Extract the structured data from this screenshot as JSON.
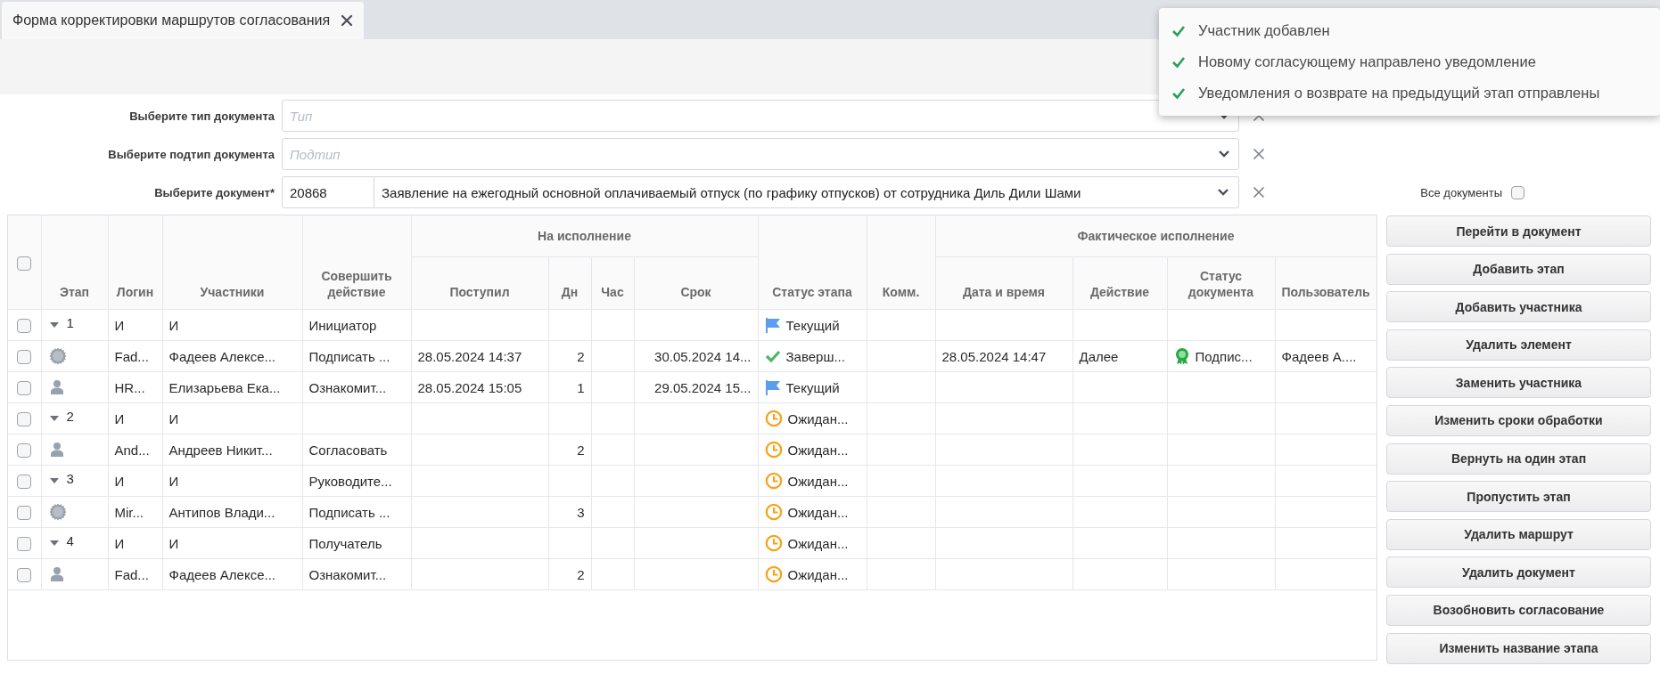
{
  "tabs": [
    {
      "label": "Форма корректировки маршрутов согласования",
      "selected": true
    }
  ],
  "form": {
    "fields": [
      {
        "kind": "select",
        "label": "Выберите тип документа",
        "placeholder": "Тип"
      },
      {
        "kind": "select",
        "label": "Выберите подтип документа",
        "placeholder": "Подтип"
      },
      {
        "kind": "document",
        "label": "Выберите документ*",
        "number": "20868",
        "value": "Заявление на ежегодный основной оплачиваемый отпуск (по графику отпусков) от сотрудника Диль Дили Шами"
      }
    ],
    "all_documents": {
      "label": "Все документы",
      "checked": false
    }
  },
  "table": {
    "select_all": {
      "checked": false
    },
    "columns": [
      {
        "label": "Этап"
      },
      {
        "label": "Логин"
      },
      {
        "label": "Участники"
      },
      {
        "label": "Совершить действие"
      },
      {
        "label": "На исполнение",
        "children": [
          {
            "label": "Поступил"
          },
          {
            "label": "Дн"
          },
          {
            "label": "Час"
          },
          {
            "label": "Срок"
          }
        ]
      },
      {
        "label": "Статус этапа"
      },
      {
        "label": "Комм."
      },
      {
        "label": "Фактическое исполнение",
        "children": [
          {
            "label": "Дата и время"
          },
          {
            "label": "Действие"
          },
          {
            "label": "Статус документа"
          },
          {
            "label": "Пользователь"
          }
        ]
      }
    ],
    "rows": [
      {
        "kind": "stage",
        "checked": false,
        "expanded": true,
        "stage": "1",
        "login": "И",
        "participant": "И",
        "action": "Инициатор",
        "status": {
          "kind": "current",
          "text": "Текущий"
        }
      },
      {
        "kind": "group",
        "checked": false,
        "login": "Fad...",
        "participant": "Фадеев Алексе...",
        "action": "Подписать ...",
        "received": "28.05.2024 14:37",
        "days": "2",
        "deadline": "30.05.2024 14...",
        "status": {
          "kind": "done",
          "text": "Заверш..."
        },
        "fact_date": "28.05.2024 14:47",
        "fact_action": "Далее",
        "doc_status": {
          "kind": "signed",
          "text": "Подпис..."
        },
        "user": "Фадеев А...."
      },
      {
        "kind": "person",
        "checked": false,
        "login": "HR...",
        "participant": "Елизарьева Ека...",
        "action": "Ознакомит...",
        "received": "28.05.2024 15:05",
        "days": "1",
        "deadline": "29.05.2024 15...",
        "status": {
          "kind": "current",
          "text": "Текущий"
        }
      },
      {
        "kind": "stage",
        "checked": false,
        "expanded": true,
        "stage": "2",
        "login": "И",
        "participant": "И",
        "status": {
          "kind": "waiting",
          "text": "Ожидан..."
        }
      },
      {
        "kind": "person",
        "checked": false,
        "login": "And...",
        "participant": "Андреев Никит...",
        "action": "Согласовать",
        "days": "2",
        "status": {
          "kind": "waiting",
          "text": "Ожидан..."
        }
      },
      {
        "kind": "stage",
        "checked": false,
        "expanded": true,
        "stage": "3",
        "login": "И",
        "participant": "И",
        "action": "Руководите...",
        "status": {
          "kind": "waiting",
          "text": "Ожидан..."
        }
      },
      {
        "kind": "group",
        "checked": false,
        "login": "Mir...",
        "participant": "Антипов Влади...",
        "action": "Подписать ...",
        "days": "3",
        "status": {
          "kind": "waiting",
          "text": "Ожидан..."
        }
      },
      {
        "kind": "stage",
        "checked": false,
        "expanded": true,
        "stage": "4",
        "login": "И",
        "participant": "И",
        "action": "Получатель",
        "status": {
          "kind": "waiting",
          "text": "Ожидан..."
        }
      },
      {
        "kind": "person",
        "checked": false,
        "login": "Fad...",
        "participant": "Фадеев Алексе...",
        "action": "Ознакомит...",
        "days": "2",
        "status": {
          "kind": "waiting",
          "text": "Ожидан..."
        }
      }
    ]
  },
  "actions": [
    "Перейти в документ",
    "Добавить этап",
    "Добавить участника",
    "Удалить элемент",
    "Заменить участника",
    "Изменить сроки обработки",
    "Вернуть на один этап",
    "Пропустить этап",
    "Удалить маршрут",
    "Удалить документ",
    "Возобновить согласование",
    "Изменить название этапа"
  ],
  "notifications": [
    {
      "kind": "success",
      "text": "Участник добавлен"
    },
    {
      "kind": "success",
      "text": "Новому согласующему направлено уведомление"
    },
    {
      "kind": "success",
      "text": "Уведомления о возврате на предыдущий этап отправлены"
    }
  ]
}
